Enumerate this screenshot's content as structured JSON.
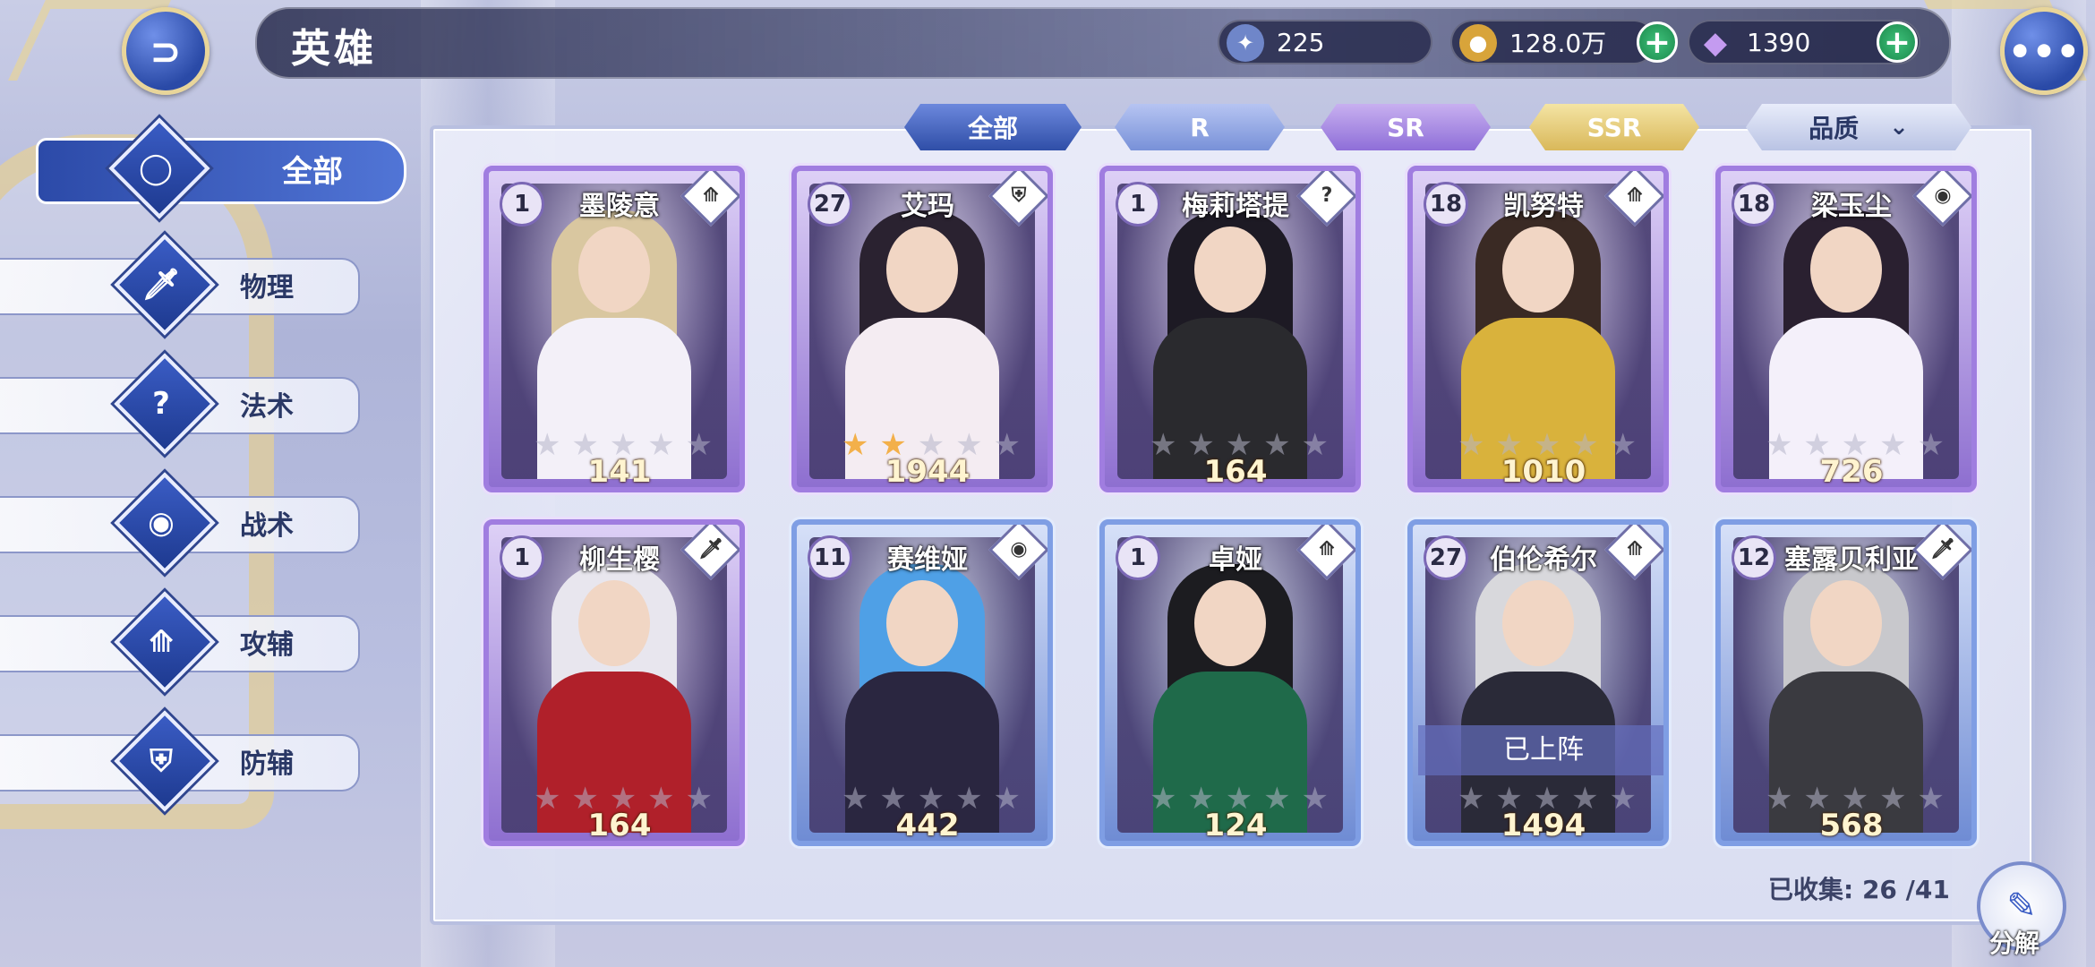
{
  "header": {
    "title": "英雄"
  },
  "resources": [
    {
      "icon": "energy-icon",
      "value": "225"
    },
    {
      "icon": "gold-coin-icon",
      "value": "128.0万"
    },
    {
      "icon": "diamond-icon",
      "value": "1390"
    }
  ],
  "categories": [
    {
      "label": "全部",
      "icon": "all-ring-icon",
      "active": true
    },
    {
      "label": "物理",
      "icon": "sword-icon"
    },
    {
      "label": "法术",
      "icon": "magic-icon"
    },
    {
      "label": "战术",
      "icon": "eye-icon"
    },
    {
      "label": "攻辅",
      "icon": "attack-support-icon"
    },
    {
      "label": "防辅",
      "icon": "shield-icon"
    }
  ],
  "tabs": {
    "all": "全部",
    "r": "R",
    "sr": "SR",
    "ssr": "SSR",
    "quality": "品质"
  },
  "heroes": [
    {
      "level": "1",
      "name": "墨陵意",
      "power": "141",
      "rarity": "SR",
      "stars": 0,
      "class": "attack-support-icon"
    },
    {
      "level": "27",
      "name": "艾玛",
      "power": "1944",
      "rarity": "SR",
      "stars": 2,
      "class": "shield-icon"
    },
    {
      "level": "1",
      "name": "梅莉塔提",
      "power": "164",
      "rarity": "SR",
      "stars": 0,
      "class": "magic-icon"
    },
    {
      "level": "18",
      "name": "凯努特",
      "power": "1010",
      "rarity": "SR",
      "stars": 0,
      "class": "attack-support-icon"
    },
    {
      "level": "18",
      "name": "梁玉尘",
      "power": "726",
      "rarity": "SR",
      "stars": 0,
      "class": "eye-icon"
    },
    {
      "level": "1",
      "name": "柳生樱",
      "power": "164",
      "rarity": "SR",
      "stars": 0,
      "class": "sword-icon"
    },
    {
      "level": "11",
      "name": "赛维娅",
      "power": "442",
      "rarity": "R",
      "stars": 0,
      "class": "eye-icon"
    },
    {
      "level": "1",
      "name": "卓娅",
      "power": "124",
      "rarity": "R",
      "stars": 0,
      "class": "attack-support-icon"
    },
    {
      "level": "27",
      "name": "伯伦希尔",
      "power": "1494",
      "rarity": "R",
      "stars": 0,
      "class": "attack-support-icon",
      "deployed": "已上阵"
    },
    {
      "level": "12",
      "name": "塞露贝利亚",
      "power": "568",
      "rarity": "R",
      "stars": 0,
      "class": "sword-icon"
    }
  ],
  "footer": {
    "collected_label": "已收集:",
    "collected_value": "26 /41",
    "decompose_label": "分解"
  },
  "colors": {
    "sr_frame": "#a07de0",
    "r_frame": "#7f9ee4",
    "accent": "#2f4ea7",
    "star": "#f3b04a"
  }
}
